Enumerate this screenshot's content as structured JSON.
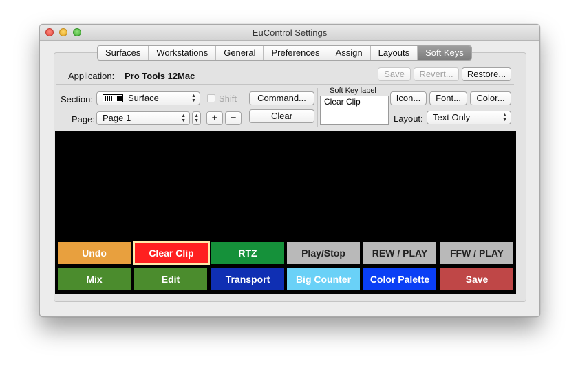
{
  "window": {
    "title": "EuControl Settings"
  },
  "tabs": [
    "Surfaces",
    "Workstations",
    "General",
    "Preferences",
    "Assign",
    "Layouts",
    "Soft Keys"
  ],
  "active_tab": "Soft Keys",
  "application": {
    "label": "Application:",
    "value": "Pro Tools 12Mac"
  },
  "actions": {
    "save": "Save",
    "revert": "Revert...",
    "restore": "Restore..."
  },
  "section": {
    "label": "Section:",
    "value": "Surface"
  },
  "page": {
    "label": "Page:",
    "value": "Page 1"
  },
  "shift_label": "Shift",
  "plus_label": "+",
  "minus_label": "−",
  "command_label": "Command...",
  "clear_label": "Clear",
  "soft_key_label": {
    "caption": "Soft Key label",
    "value": "Clear Clip"
  },
  "icon_label": "Icon...",
  "font_label": "Font...",
  "color_label": "Color...",
  "layout": {
    "label": "Layout:",
    "value": "Text Only"
  },
  "keys": [
    {
      "label": "Undo",
      "color": "#e8a03e",
      "text_color": "#ffffff"
    },
    {
      "label": "Clear Clip",
      "color": "#ff2020",
      "text_color": "#ffffff",
      "selected": true
    },
    {
      "label": "RTZ",
      "color": "#15913a",
      "text_color": "#ffffff"
    },
    {
      "label": "Play/Stop",
      "color": "#b9b9b9",
      "text_color": "#222222"
    },
    {
      "label": "REW / PLAY",
      "color": "#b9b9b9",
      "text_color": "#222222"
    },
    {
      "label": "FFW / PLAY",
      "color": "#b9b9b9",
      "text_color": "#222222"
    },
    {
      "label": "Mix",
      "color": "#4b8c2d",
      "text_color": "#ffffff"
    },
    {
      "label": "Edit",
      "color": "#4b8c2d",
      "text_color": "#ffffff"
    },
    {
      "label": "Transport",
      "color": "#0f2fb3",
      "text_color": "#ffffff"
    },
    {
      "label": "Big Counter",
      "color": "#6ad1f7",
      "text_color": "#ffffff"
    },
    {
      "label": "Color Palette",
      "color": "#0a3ff5",
      "text_color": "#ffffff"
    },
    {
      "label": "Save",
      "color": "#bf4747",
      "text_color": "#ffffff"
    }
  ]
}
